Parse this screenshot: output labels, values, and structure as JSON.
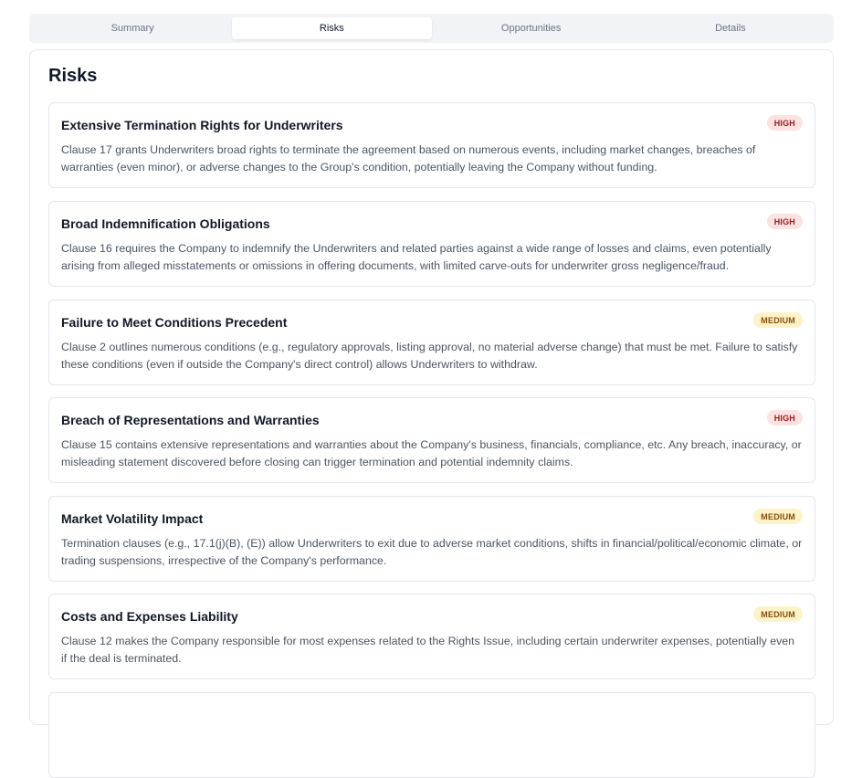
{
  "tabs": [
    {
      "label": "Summary",
      "active": false
    },
    {
      "label": "Risks",
      "active": true
    },
    {
      "label": "Opportunities",
      "active": false
    },
    {
      "label": "Details",
      "active": false
    }
  ],
  "panel": {
    "title": "Risks"
  },
  "risks": [
    {
      "title": "Extensive Termination Rights for Underwriters",
      "severity": "HIGH",
      "description": "Clause 17 grants Underwriters broad rights to terminate the agreement based on numerous events, including market changes, breaches of warranties (even minor), or adverse changes to the Group's condition, potentially leaving the Company without funding."
    },
    {
      "title": "Broad Indemnification Obligations",
      "severity": "HIGH",
      "description": "Clause 16 requires the Company to indemnify the Underwriters and related parties against a wide range of losses and claims, even potentially arising from alleged misstatements or omissions in offering documents, with limited carve-outs for underwriter gross negligence/fraud."
    },
    {
      "title": "Failure to Meet Conditions Precedent",
      "severity": "MEDIUM",
      "description": "Clause 2 outlines numerous conditions (e.g., regulatory approvals, listing approval, no material adverse change) that must be met. Failure to satisfy these conditions (even if outside the Company's direct control) allows Underwriters to withdraw."
    },
    {
      "title": "Breach of Representations and Warranties",
      "severity": "HIGH",
      "description": "Clause 15 contains extensive representations and warranties about the Company's business, financials, compliance, etc. Any breach, inaccuracy, or misleading statement discovered before closing can trigger termination and potential indemnity claims."
    },
    {
      "title": "Market Volatility Impact",
      "severity": "MEDIUM",
      "description": "Termination clauses (e.g., 17.1(j)(B), (E)) allow Underwriters to exit due to adverse market conditions, shifts in financial/political/economic climate, or trading suspensions, irrespective of the Company's performance."
    },
    {
      "title": "Costs and Expenses Liability",
      "severity": "MEDIUM",
      "description": "Clause 12 makes the Company responsible for most expenses related to the Rights Issue, including certain underwriter expenses, potentially even if the deal is terminated."
    },
    {
      "title": "",
      "severity": "",
      "description": ""
    }
  ],
  "colors": {
    "high_bg": "#fde2e2",
    "high_text": "#991b1b",
    "medium_bg": "#fef3c7",
    "medium_text": "#854d0e",
    "tab_bar_bg": "#f1f3f6"
  }
}
